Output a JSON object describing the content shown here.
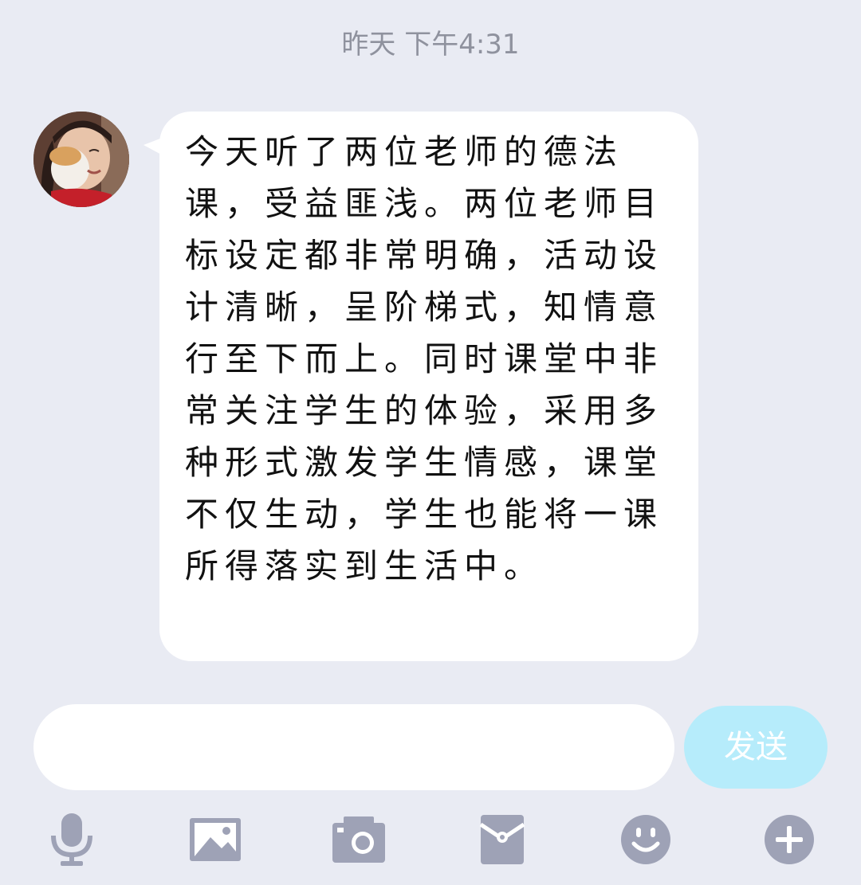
{
  "chat": {
    "timestamp": "昨天 下午4:31",
    "message": {
      "text": "今天听了两位老师的德法课，受益匪浅。两位老师目标设定都非常明确，活动设计清晰，呈阶梯式，知情意行至下而上。同时课堂中非常关注学生的体验，采用多种形式激发学生情感，课堂不仅生动，学生也能将一课所得落实到生活中。"
    }
  },
  "composer": {
    "input_value": "",
    "send_label": "发送"
  },
  "toolbar": {
    "icons": [
      "microphone-icon",
      "image-icon",
      "camera-icon",
      "red-packet-icon",
      "emoji-icon",
      "plus-icon"
    ]
  },
  "colors": {
    "background": "#e9ebf3",
    "bubble": "#ffffff",
    "send_button": "#b6ecfb",
    "icon": "#9ea2b6",
    "timestamp": "#8f929e"
  }
}
